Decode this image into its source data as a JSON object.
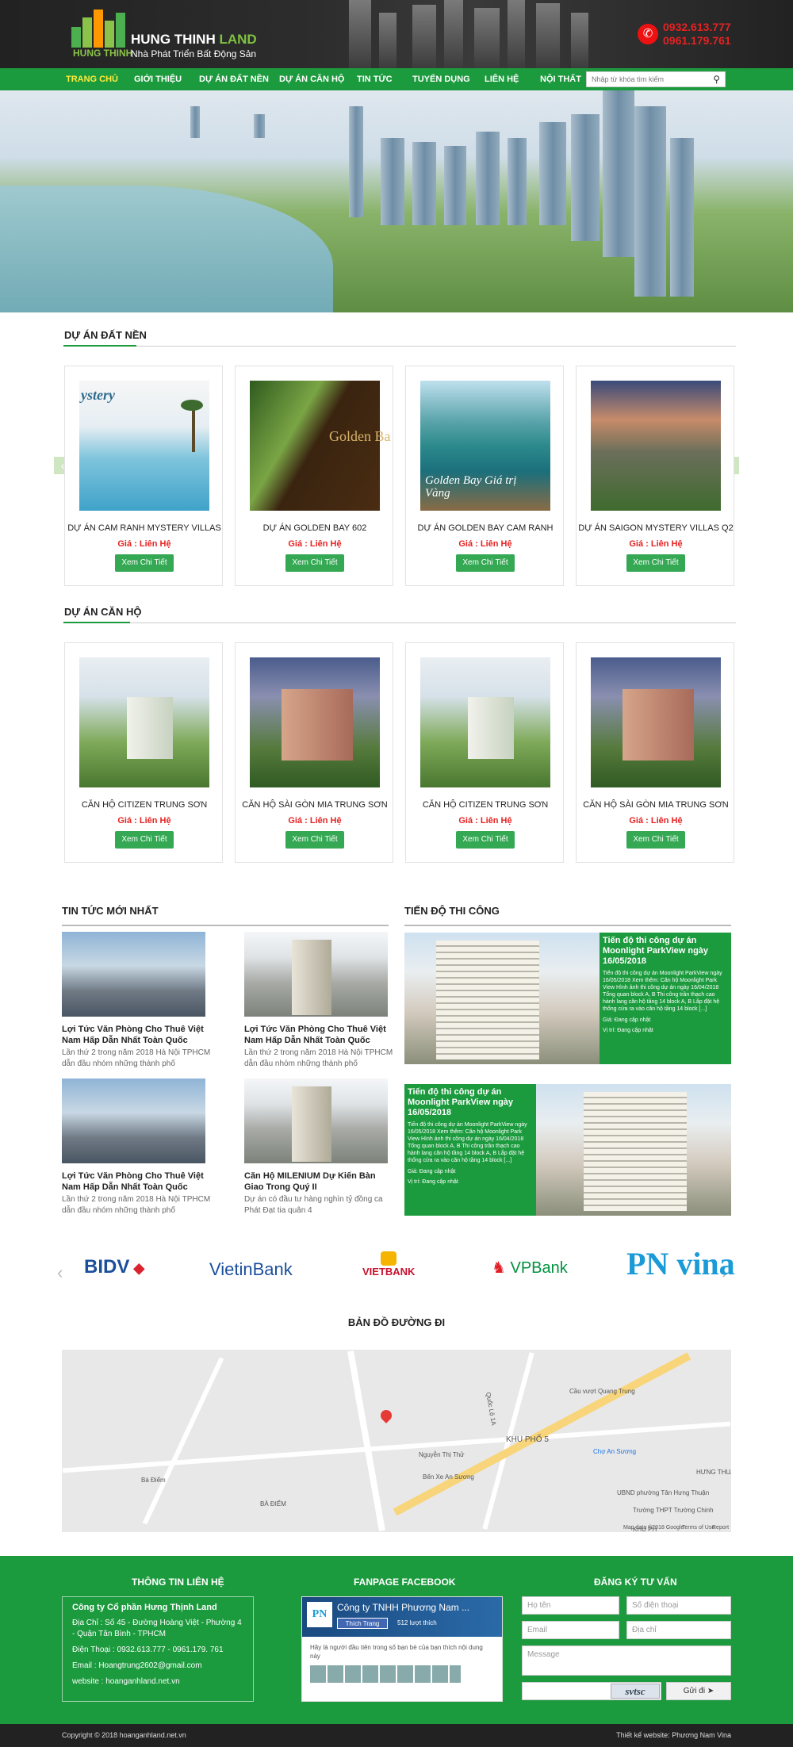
{
  "header": {
    "logo_name_main": "HUNG THINH",
    "logo_name_accent": " LAND",
    "logo_sub": "HUNG THINH",
    "tagline": "Nhà Phát Triển Bất Động Sản",
    "phone_1": "0932.613.777",
    "phone_2": "0961.179.761",
    "colors": {
      "brand_green": "#1c9a3e",
      "phone_red": "#e52222"
    }
  },
  "nav": {
    "items": [
      "TRANG CHỦ",
      "GIỚI THIỆU",
      "DỰ ÁN ĐẤT NỀN",
      "DỰ ÁN CĂN HỘ",
      "TIN TỨC",
      "TUYỂN DỤNG",
      "LIÊN HỆ",
      "NỘI THẤT"
    ],
    "active": "TRANG CHỦ",
    "search_placeholder": "Nhập từ khóa tìm kiếm"
  },
  "land_projects": {
    "title": "DỰ ÁN ĐẤT NỀN",
    "items": [
      {
        "name": "DỰ ÁN CAM RANH MYSTERY VILLAS",
        "price": "Giá : Liên Hệ",
        "button": "Xem Chi Tiết",
        "image_text": "ystery"
      },
      {
        "name": "DỰ ÁN GOLDEN BAY 602",
        "price": "Giá : Liên Hệ",
        "button": "Xem Chi Tiết",
        "image_text": "Golden Ba"
      },
      {
        "name": "DỰ ÁN GOLDEN BAY CAM RANH",
        "price": "Giá : Liên Hệ",
        "button": "Xem Chi Tiết",
        "image_text": "Golden Bay Giá trị Vàng"
      },
      {
        "name": "DỰ ÁN SAIGON MYSTERY VILLAS Q2",
        "price": "Giá : Liên Hệ",
        "button": "Xem Chi Tiết",
        "image_text": ""
      }
    ]
  },
  "apartment_projects": {
    "title": "DỰ ÁN CĂN HỘ",
    "items": [
      {
        "name": "CĂN HỘ CITIZEN TRUNG SƠN",
        "price": "Giá : Liên Hệ",
        "button": "Xem Chi Tiết"
      },
      {
        "name": "CĂN HỘ SÀI GÒN MIA TRUNG SƠN",
        "price": "Giá : Liên Hệ",
        "button": "Xem Chi Tiết"
      },
      {
        "name": "CĂN HỘ CITIZEN TRUNG SƠN",
        "price": "Giá : Liên Hệ",
        "button": "Xem Chi Tiết"
      },
      {
        "name": "CĂN HỘ SÀI GÒN MIA TRUNG SƠN",
        "price": "Giá : Liên Hệ",
        "button": "Xem Chi Tiết"
      }
    ]
  },
  "news": {
    "title": "TIN TỨC MỚI NHẤT",
    "items": [
      {
        "title": "Lợi Tức Văn Phòng Cho Thuê Việt Nam Hấp Dẫn Nhất Toàn Quốc",
        "desc": "Lần thứ 2 trong năm 2018 Hà Nội TPHCM dẫn đầu nhóm những thành phố"
      },
      {
        "title": "Lợi Tức Văn Phòng Cho Thuê Việt Nam Hấp Dẫn Nhất Toàn Quốc",
        "desc": "Lần thứ 2 trong năm 2018 Hà Nội TPHCM dẫn đầu nhóm những thành phố"
      },
      {
        "title": "Lợi Tức Văn Phòng Cho Thuê Việt Nam Hấp Dẫn Nhất Toàn Quốc",
        "desc": "Lần thứ 2 trong năm 2018 Hà Nội TPHCM dẫn đầu nhóm những thành phố"
      },
      {
        "title": "Căn Hộ MILENIUM Dự Kiến Bàn Giao Trong Quý II",
        "desc": "Dự án có đầu tư hàng nghìn tỷ đồng ca Phát Đạt tia quân 4"
      }
    ]
  },
  "progress": {
    "title": "TIẾN ĐỘ THI CÔNG",
    "items": [
      {
        "title": "Tiến độ thi công dự án Moonlight ParkView ngày 16/05/2018",
        "desc": "Tiến độ thi công dự án Moonlight ParkView ngày 16/05/2018 Xem thêm: Căn hộ Moonlight Park View Hình ảnh thi công dự án ngày 16/04/2018 Tổng quan block A, B Thi công trần thạch cao hành lang căn hộ tầng 14 block A, B Lắp đặt hệ thống cửa ra vào căn hộ tầng 14 block [...]",
        "price": "Giá: Đang cập nhật",
        "location": "Vị trí: Đang cập nhật"
      },
      {
        "title": "Tiến độ thi công dự án Moonlight ParkView ngày 16/05/2018",
        "desc": "Tiến độ thi công dự án Moonlight ParkView ngày 16/05/2018 Xem thêm: Căn hộ Moonlight Park View Hình ảnh thi công dự án ngày 16/04/2018 Tổng quan block A, B Thi công trần thạch cao hành lang căn hộ tầng 14 block A, B Lắp đặt hệ thống cửa ra vào căn hộ tầng 14 block [...]",
        "price": "Giá: Đang cập nhật",
        "location": "Vị trí: Đang cập nhật"
      }
    ]
  },
  "partners": {
    "items": [
      "BIDV",
      "VietinBank",
      "VIETBANK",
      "VPBank",
      "PN vina"
    ],
    "colors": {
      "bidv": "#1b4f9c",
      "vietin": "#d9232e",
      "vietbank": "#c8102e",
      "vpbank": "#00923f",
      "pnvina": "#1a9bd7"
    }
  },
  "map": {
    "title": "BẢN ĐỒ ĐƯỜNG ĐI",
    "labels": [
      "Cầu vượt Quang Trung",
      "KHU PHỐ 5",
      "Chợ An Sương",
      "Bến Xe An Sương",
      "UBND phường Tân Hưng Thuận",
      "Trường THPT Trường Chinh",
      "HƯNG THUẬN",
      "KHU PH",
      "BÀ ĐIỂM",
      "Bà Điểm",
      "Nguyễn Thị Thử",
      "Quốc Lộ 1A",
      "Map data ©2018 Google",
      "Terms of Use",
      "Report"
    ]
  },
  "footer": {
    "contact_title": "THÔNG TIN LIÊN HỆ",
    "company": "Công ty Cổ phần Hưng Thịnh Land",
    "address": "Địa Chỉ : Số 45 - Đường Hoàng Việt - Phường 4 - Quận Tân Bình - TPHCM",
    "phone": "Điện Thoại : 0932.613.777 - 0961.179. 761",
    "email": "Email : Hoangtrung2602@gmail.com",
    "website": "website : hoanganhland.net.vn",
    "fanpage_title": "FANPAGE FACEBOOK",
    "fb_page_name": "Công ty TNHH Phương Nam ...",
    "fb_like": "Thích Trang",
    "fb_likes_count": "512 lượt thích",
    "fb_note": "Hãy là người đầu tiên trong số bạn bè của bạn thích nội dung này",
    "consult_title": "ĐĂNG KÝ TƯ VẤN",
    "form": {
      "name": "Họ tên",
      "phone": "Số điện thoại",
      "email": "Email",
      "address": "Địa chỉ",
      "message": "Message",
      "captcha": "svtsc",
      "submit": "Gửi đi"
    },
    "copyright": "Copyright © 2018 hoanganhland.net.vn",
    "designer": "Thiết kế website: Phương Nam Vina"
  }
}
